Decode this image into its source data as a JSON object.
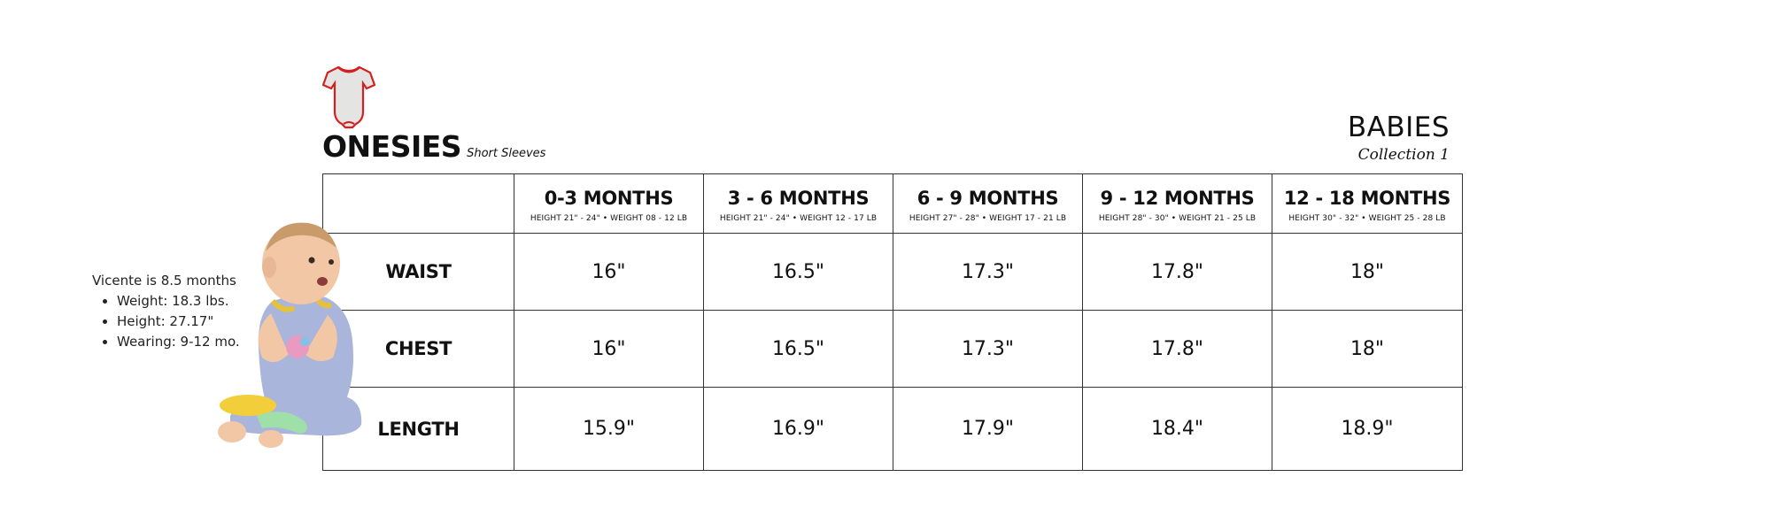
{
  "header": {
    "title": "ONESIES",
    "subtitle": "Short Sleeves",
    "category": "BABIES",
    "collection": "Collection 1"
  },
  "colors": {
    "border": "#333333",
    "onesie_body": "#e4e4e2",
    "onesie_trim": "#d32020",
    "baby_outfit": "#aab5dc",
    "baby_skin": "#f2c7a5"
  },
  "table": {
    "columns": [
      {
        "label": "0-3 MONTHS",
        "detail": "HEIGHT 21\" - 24\"  •  WEIGHT 08 - 12 LB"
      },
      {
        "label": "3 - 6 MONTHS",
        "detail": "HEIGHT 21\" - 24\"  •  WEIGHT 12 - 17 LB"
      },
      {
        "label": "6 - 9 MONTHS",
        "detail": "HEIGHT 27\" - 28\"  •  WEIGHT 17 - 21 LB"
      },
      {
        "label": "9 - 12 MONTHS",
        "detail": "HEIGHT 28\" - 30\"  •  WEIGHT 21 - 25 LB"
      },
      {
        "label": "12 - 18 MONTHS",
        "detail": "HEIGHT 30\" - 32\"  •  WEIGHT 25 - 28 LB"
      }
    ],
    "rows": [
      {
        "label": "WAIST",
        "values": [
          "16\"",
          "16.5\"",
          "17.3\"",
          "17.8\"",
          "18\""
        ]
      },
      {
        "label": "CHEST",
        "values": [
          "16\"",
          "16.5\"",
          "17.3\"",
          "17.8\"",
          "18\""
        ]
      },
      {
        "label": "LENGTH",
        "values": [
          "15.9\"",
          "16.9\"",
          "17.9\"",
          "18.4\"",
          "18.9\""
        ]
      }
    ]
  },
  "model": {
    "intro": "Vicente is 8.5 months",
    "details": [
      "Weight: 18.3 lbs.",
      "Height: 27.17\"",
      "Wearing: 9-12 mo."
    ]
  },
  "images": {
    "onesie": "onesie-icon",
    "baby": "baby-photo"
  }
}
